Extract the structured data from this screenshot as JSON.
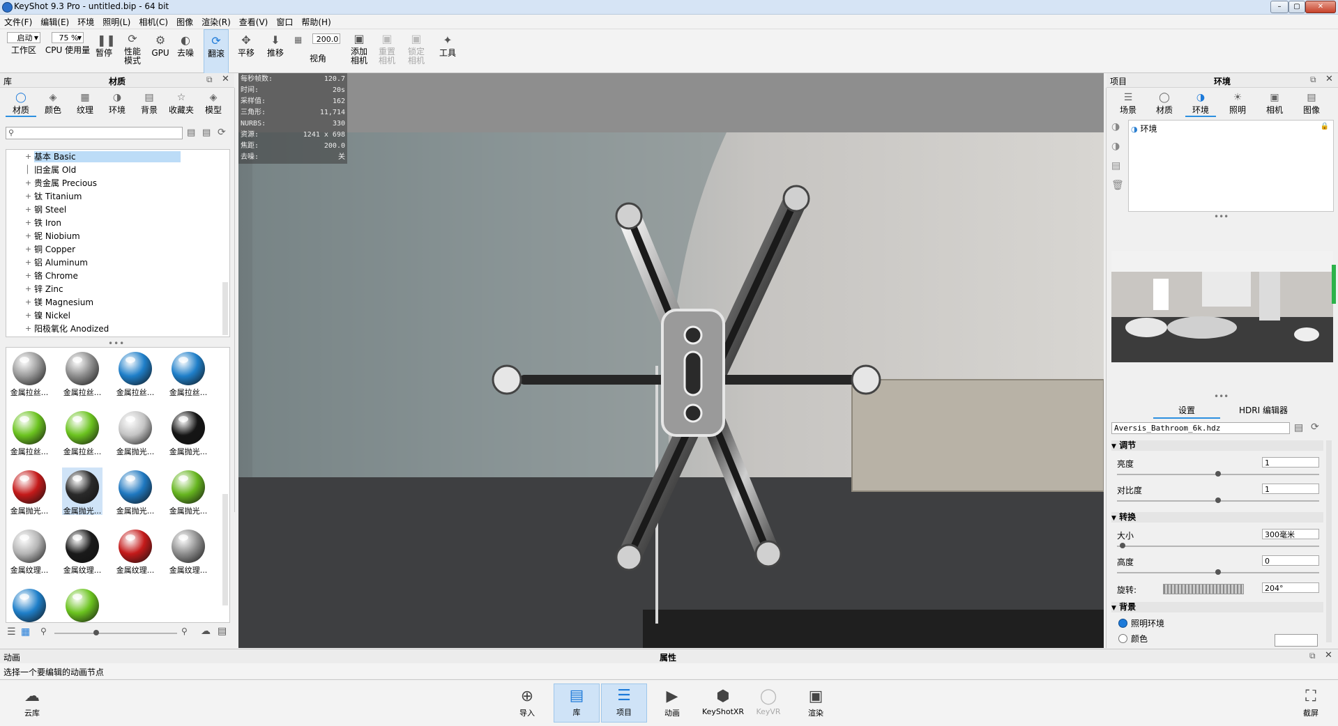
{
  "window": {
    "title": "KeyShot 9.3 Pro  - untitled.bip  - 64 bit"
  },
  "menu": [
    "文件(F)",
    "编辑(E)",
    "环境",
    "照明(L)",
    "相机(C)",
    "图像",
    "渲染(R)",
    "查看(V)",
    "窗口",
    "帮助(H)"
  ],
  "toolbar": {
    "workspace_value": "启动",
    "workspace_label": "工作区",
    "cpu_value": "75 %",
    "cpu_label": "CPU 使用量",
    "pause": "暂停",
    "perf_mode": "性能\n模式",
    "gpu": "GPU",
    "denoise": "去噪",
    "tumble": "翻滚",
    "pan": "平移",
    "dolly": "推移",
    "fov_value": "200.0",
    "fov_label": "视角",
    "add_camera": "添加\n相机",
    "reset_camera": "重置\n相机",
    "lock_camera": "锁定\n相机",
    "tools": "工具"
  },
  "library": {
    "panel_label": "库",
    "panel_title": "材质",
    "tabs": [
      "材质",
      "颜色",
      "纹理",
      "环境",
      "背景",
      "收藏夹",
      "模型"
    ],
    "active_tab": "材质",
    "tree": [
      "基本 Basic",
      "旧金属 Old",
      "贵金属 Precious",
      "钛 Titanium",
      "钢 Steel",
      "铁 Iron",
      "铌 Niobium",
      "铜 Copper",
      "铝 Aluminum",
      "铬 Chrome",
      "锌 Zinc",
      "镁 Magnesium",
      "镍 Nickel",
      "阳极氧化 Anodized"
    ],
    "selected_tree_item": "基本 Basic",
    "thumbnails": [
      {
        "label": "金属拉丝...",
        "color": "#9a9a9a"
      },
      {
        "label": "金属拉丝...",
        "color": "#8d8d8d"
      },
      {
        "label": "金属拉丝...",
        "color": "#1f7fc9"
      },
      {
        "label": "金属拉丝...",
        "color": "#1f7fc9"
      },
      {
        "label": "金属拉丝...",
        "color": "#6bc31f"
      },
      {
        "label": "金属拉丝...",
        "color": "#6bc31f"
      },
      {
        "label": "金属抛光...",
        "color": "#c4c4c4"
      },
      {
        "label": "金属抛光...",
        "color": "#151515"
      },
      {
        "label": "金属抛光...",
        "color": "#c41a1a"
      },
      {
        "label": "金属抛光...",
        "color": "#2a2a2a"
      },
      {
        "label": "金属抛光...",
        "color": "#1f78c0"
      },
      {
        "label": "金属抛光...",
        "color": "#66b51f"
      },
      {
        "label": "金属纹理...",
        "color": "#b5b5b5"
      },
      {
        "label": "金属纹理...",
        "color": "#1a1a1a"
      },
      {
        "label": "金属纹理...",
        "color": "#c41a1a"
      },
      {
        "label": "金属纹理...",
        "color": "#8e8e8e"
      },
      {
        "label": "",
        "color": "#1f7fc9"
      },
      {
        "label": "",
        "color": "#6bc31f"
      }
    ]
  },
  "stats": [
    {
      "k": "每秒帧数:",
      "v": "120.7"
    },
    {
      "k": "时间:",
      "v": "20s"
    },
    {
      "k": "采样值:",
      "v": "162"
    },
    {
      "k": "三角形:",
      "v": "11,714"
    },
    {
      "k": "NURBS:",
      "v": "330"
    },
    {
      "k": "资源:",
      "v": "1241 x 698"
    },
    {
      "k": "焦距:",
      "v": "200.0"
    },
    {
      "k": "去噪:",
      "v": "关"
    }
  ],
  "project": {
    "panel_label": "项目",
    "panel_title": "环境",
    "tabs": [
      "场景",
      "材质",
      "环境",
      "照明",
      "相机",
      "图像"
    ],
    "active_tab": "环境",
    "env_list_item": "环境",
    "subtabs": [
      "设置",
      "HDRI 编辑器"
    ],
    "hdri_file": "Aversis_Bathroom_6k.hdz",
    "sections": {
      "adjust": "调节",
      "brightness_label": "亮度",
      "brightness_value": "1",
      "contrast_label": "对比度",
      "contrast_value": "1",
      "transform": "转换",
      "size_label": "大小",
      "size_value": "300毫米",
      "height_label": "高度",
      "height_value": "0",
      "rotation_label": "旋转:",
      "rotation_value": "204°",
      "background": "背景",
      "bg_option1": "照明环境",
      "bg_option2": "颜色"
    }
  },
  "animation": {
    "panel_label": "动画",
    "properties_title": "属性",
    "hint": "选择一个要编辑的动画节点"
  },
  "bottombar": {
    "cloud": "云库",
    "import": "导入",
    "library": "库",
    "project": "项目",
    "animation": "动画",
    "keyshotxr": "KeyShotXR",
    "keyvr": "KeyVR",
    "render": "渲染",
    "screenshot": "截屏"
  }
}
